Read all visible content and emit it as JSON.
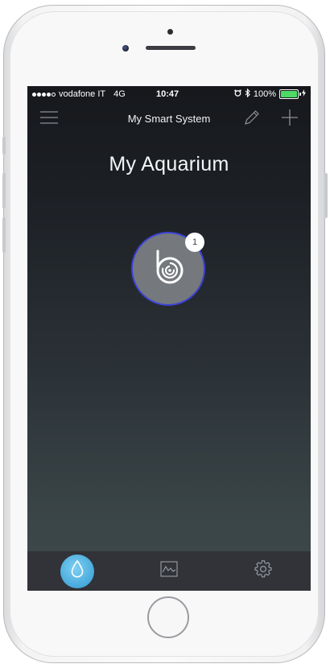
{
  "status_bar": {
    "carrier": "vodafone IT",
    "network": "4G",
    "time": "10:47",
    "battery_text": "100%",
    "battery_level": 1.0,
    "battery_color": "#4cd964",
    "icons": [
      "signal-dots-icon",
      "alarm-icon",
      "bluetooth-icon",
      "battery-icon",
      "charging-icon"
    ]
  },
  "nav": {
    "title": "My Smart System",
    "left_icon": "menu-icon",
    "right_icons": [
      "edit-pencil-icon",
      "add-plus-icon"
    ]
  },
  "page": {
    "title": "My Aquarium"
  },
  "device": {
    "icon": "pump-logo-icon",
    "badge_count": "1",
    "ring_color": "#3c42d6"
  },
  "tab_bar": {
    "tabs": [
      {
        "icon": "water-drop-icon",
        "active": true
      },
      {
        "icon": "chart-icon",
        "active": false
      },
      {
        "icon": "settings-gear-icon",
        "active": false
      }
    ],
    "active_color": "#47a9dc"
  }
}
